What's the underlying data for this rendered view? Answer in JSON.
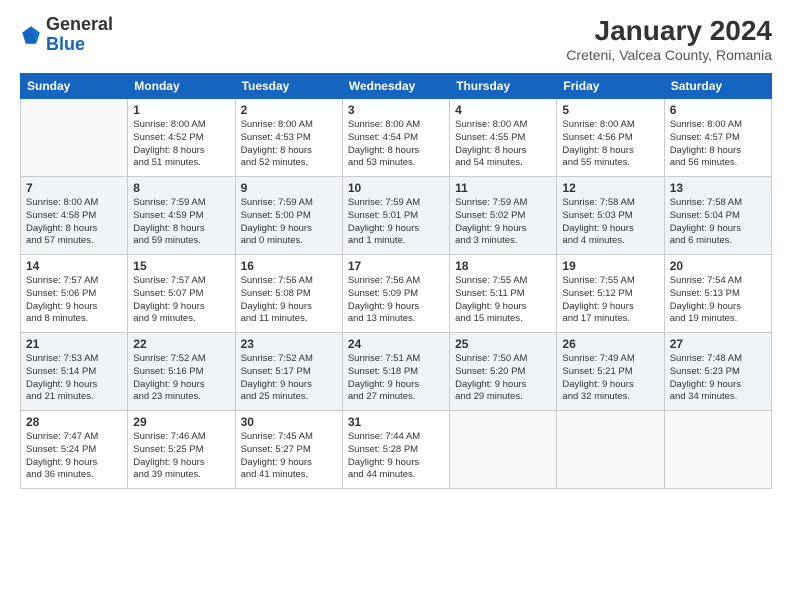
{
  "logo": {
    "general": "General",
    "blue": "Blue"
  },
  "header": {
    "month_year": "January 2024",
    "location": "Creteni, Valcea County, Romania"
  },
  "days_of_week": [
    "Sunday",
    "Monday",
    "Tuesday",
    "Wednesday",
    "Thursday",
    "Friday",
    "Saturday"
  ],
  "weeks": [
    [
      {
        "day": "",
        "info": ""
      },
      {
        "day": "1",
        "info": "Sunrise: 8:00 AM\nSunset: 4:52 PM\nDaylight: 8 hours\nand 51 minutes."
      },
      {
        "day": "2",
        "info": "Sunrise: 8:00 AM\nSunset: 4:53 PM\nDaylight: 8 hours\nand 52 minutes."
      },
      {
        "day": "3",
        "info": "Sunrise: 8:00 AM\nSunset: 4:54 PM\nDaylight: 8 hours\nand 53 minutes."
      },
      {
        "day": "4",
        "info": "Sunrise: 8:00 AM\nSunset: 4:55 PM\nDaylight: 8 hours\nand 54 minutes."
      },
      {
        "day": "5",
        "info": "Sunrise: 8:00 AM\nSunset: 4:56 PM\nDaylight: 8 hours\nand 55 minutes."
      },
      {
        "day": "6",
        "info": "Sunrise: 8:00 AM\nSunset: 4:57 PM\nDaylight: 8 hours\nand 56 minutes."
      }
    ],
    [
      {
        "day": "7",
        "info": "Sunrise: 8:00 AM\nSunset: 4:58 PM\nDaylight: 8 hours\nand 57 minutes."
      },
      {
        "day": "8",
        "info": "Sunrise: 7:59 AM\nSunset: 4:59 PM\nDaylight: 8 hours\nand 59 minutes."
      },
      {
        "day": "9",
        "info": "Sunrise: 7:59 AM\nSunset: 5:00 PM\nDaylight: 9 hours\nand 0 minutes."
      },
      {
        "day": "10",
        "info": "Sunrise: 7:59 AM\nSunset: 5:01 PM\nDaylight: 9 hours\nand 1 minute."
      },
      {
        "day": "11",
        "info": "Sunrise: 7:59 AM\nSunset: 5:02 PM\nDaylight: 9 hours\nand 3 minutes."
      },
      {
        "day": "12",
        "info": "Sunrise: 7:58 AM\nSunset: 5:03 PM\nDaylight: 9 hours\nand 4 minutes."
      },
      {
        "day": "13",
        "info": "Sunrise: 7:58 AM\nSunset: 5:04 PM\nDaylight: 9 hours\nand 6 minutes."
      }
    ],
    [
      {
        "day": "14",
        "info": "Sunrise: 7:57 AM\nSunset: 5:06 PM\nDaylight: 9 hours\nand 8 minutes."
      },
      {
        "day": "15",
        "info": "Sunrise: 7:57 AM\nSunset: 5:07 PM\nDaylight: 9 hours\nand 9 minutes."
      },
      {
        "day": "16",
        "info": "Sunrise: 7:56 AM\nSunset: 5:08 PM\nDaylight: 9 hours\nand 11 minutes."
      },
      {
        "day": "17",
        "info": "Sunrise: 7:56 AM\nSunset: 5:09 PM\nDaylight: 9 hours\nand 13 minutes."
      },
      {
        "day": "18",
        "info": "Sunrise: 7:55 AM\nSunset: 5:11 PM\nDaylight: 9 hours\nand 15 minutes."
      },
      {
        "day": "19",
        "info": "Sunrise: 7:55 AM\nSunset: 5:12 PM\nDaylight: 9 hours\nand 17 minutes."
      },
      {
        "day": "20",
        "info": "Sunrise: 7:54 AM\nSunset: 5:13 PM\nDaylight: 9 hours\nand 19 minutes."
      }
    ],
    [
      {
        "day": "21",
        "info": "Sunrise: 7:53 AM\nSunset: 5:14 PM\nDaylight: 9 hours\nand 21 minutes."
      },
      {
        "day": "22",
        "info": "Sunrise: 7:52 AM\nSunset: 5:16 PM\nDaylight: 9 hours\nand 23 minutes."
      },
      {
        "day": "23",
        "info": "Sunrise: 7:52 AM\nSunset: 5:17 PM\nDaylight: 9 hours\nand 25 minutes."
      },
      {
        "day": "24",
        "info": "Sunrise: 7:51 AM\nSunset: 5:18 PM\nDaylight: 9 hours\nand 27 minutes."
      },
      {
        "day": "25",
        "info": "Sunrise: 7:50 AM\nSunset: 5:20 PM\nDaylight: 9 hours\nand 29 minutes."
      },
      {
        "day": "26",
        "info": "Sunrise: 7:49 AM\nSunset: 5:21 PM\nDaylight: 9 hours\nand 32 minutes."
      },
      {
        "day": "27",
        "info": "Sunrise: 7:48 AM\nSunset: 5:23 PM\nDaylight: 9 hours\nand 34 minutes."
      }
    ],
    [
      {
        "day": "28",
        "info": "Sunrise: 7:47 AM\nSunset: 5:24 PM\nDaylight: 9 hours\nand 36 minutes."
      },
      {
        "day": "29",
        "info": "Sunrise: 7:46 AM\nSunset: 5:25 PM\nDaylight: 9 hours\nand 39 minutes."
      },
      {
        "day": "30",
        "info": "Sunrise: 7:45 AM\nSunset: 5:27 PM\nDaylight: 9 hours\nand 41 minutes."
      },
      {
        "day": "31",
        "info": "Sunrise: 7:44 AM\nSunset: 5:28 PM\nDaylight: 9 hours\nand 44 minutes."
      },
      {
        "day": "",
        "info": ""
      },
      {
        "day": "",
        "info": ""
      },
      {
        "day": "",
        "info": ""
      }
    ]
  ]
}
